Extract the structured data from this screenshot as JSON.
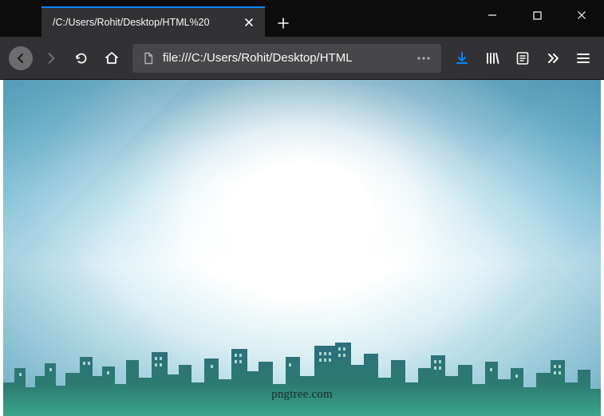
{
  "tab": {
    "title": "/C:/Users/Rohit/Desktop/HTML%20"
  },
  "url_bar": {
    "display_text": "file:///C:/Users/Rohit/Desktop/HTML"
  },
  "content": {
    "watermark": "pngtree.com"
  },
  "icons": {
    "close": "close-icon",
    "new_tab": "plus-icon",
    "minimize": "minimize-icon",
    "maximize": "maximize-icon",
    "win_close": "close-icon",
    "back": "back-icon",
    "forward": "forward-icon",
    "reload": "reload-icon",
    "home": "home-icon",
    "identity": "file-icon",
    "page_actions": "ellipsis-icon",
    "downloads": "download-icon",
    "library": "library-icon",
    "reader": "reader-view-icon",
    "overflow": "chevrons-right-icon",
    "menu": "hamburger-icon"
  }
}
